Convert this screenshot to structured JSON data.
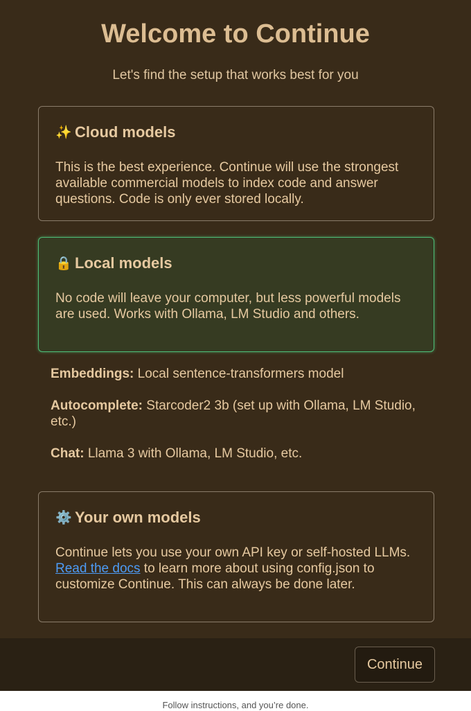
{
  "header": {
    "title": "Welcome to Continue",
    "subtitle": "Let's find the setup that works best for you"
  },
  "options": {
    "cloud": {
      "icon": "sparkles-icon",
      "icon_glyph": "✨",
      "title": "Cloud models",
      "body": "This is the best experience. Continue will use the strongest available commercial models to index code and answer questions. Code is only ever stored locally."
    },
    "local": {
      "icon": "lock-icon",
      "icon_glyph": "🔒",
      "title": "Local models",
      "body": "No code will leave your computer, but less powerful models are used. Works with Ollama, LM Studio and others.",
      "selected": true,
      "accent_color": "#4dbd78"
    },
    "own": {
      "icon": "gear-icon",
      "icon_glyph": "⚙️",
      "title": "Your own models",
      "body_before": "Continue lets you use your own API key or self-hosted LLMs. ",
      "link_text": "Read the docs",
      "body_after": " to learn more about using config.json to customize Continue. This can always be done later."
    }
  },
  "local_details": {
    "embeddings_label": "Embeddings:",
    "embeddings_value": " Local sentence-transformers model",
    "autocomplete_label": "Autocomplete:",
    "autocomplete_value": " Starcoder2 3b (set up with Ollama, LM Studio, etc.)",
    "chat_label": "Chat:",
    "chat_value": " Llama 3 with Ollama, LM Studio, etc."
  },
  "footer": {
    "continue_label": "Continue"
  },
  "caption": "Follow instructions, and you’re done.",
  "colors": {
    "background": "#392b19",
    "text": "#e6c9a0",
    "link": "#4d9bf5"
  }
}
